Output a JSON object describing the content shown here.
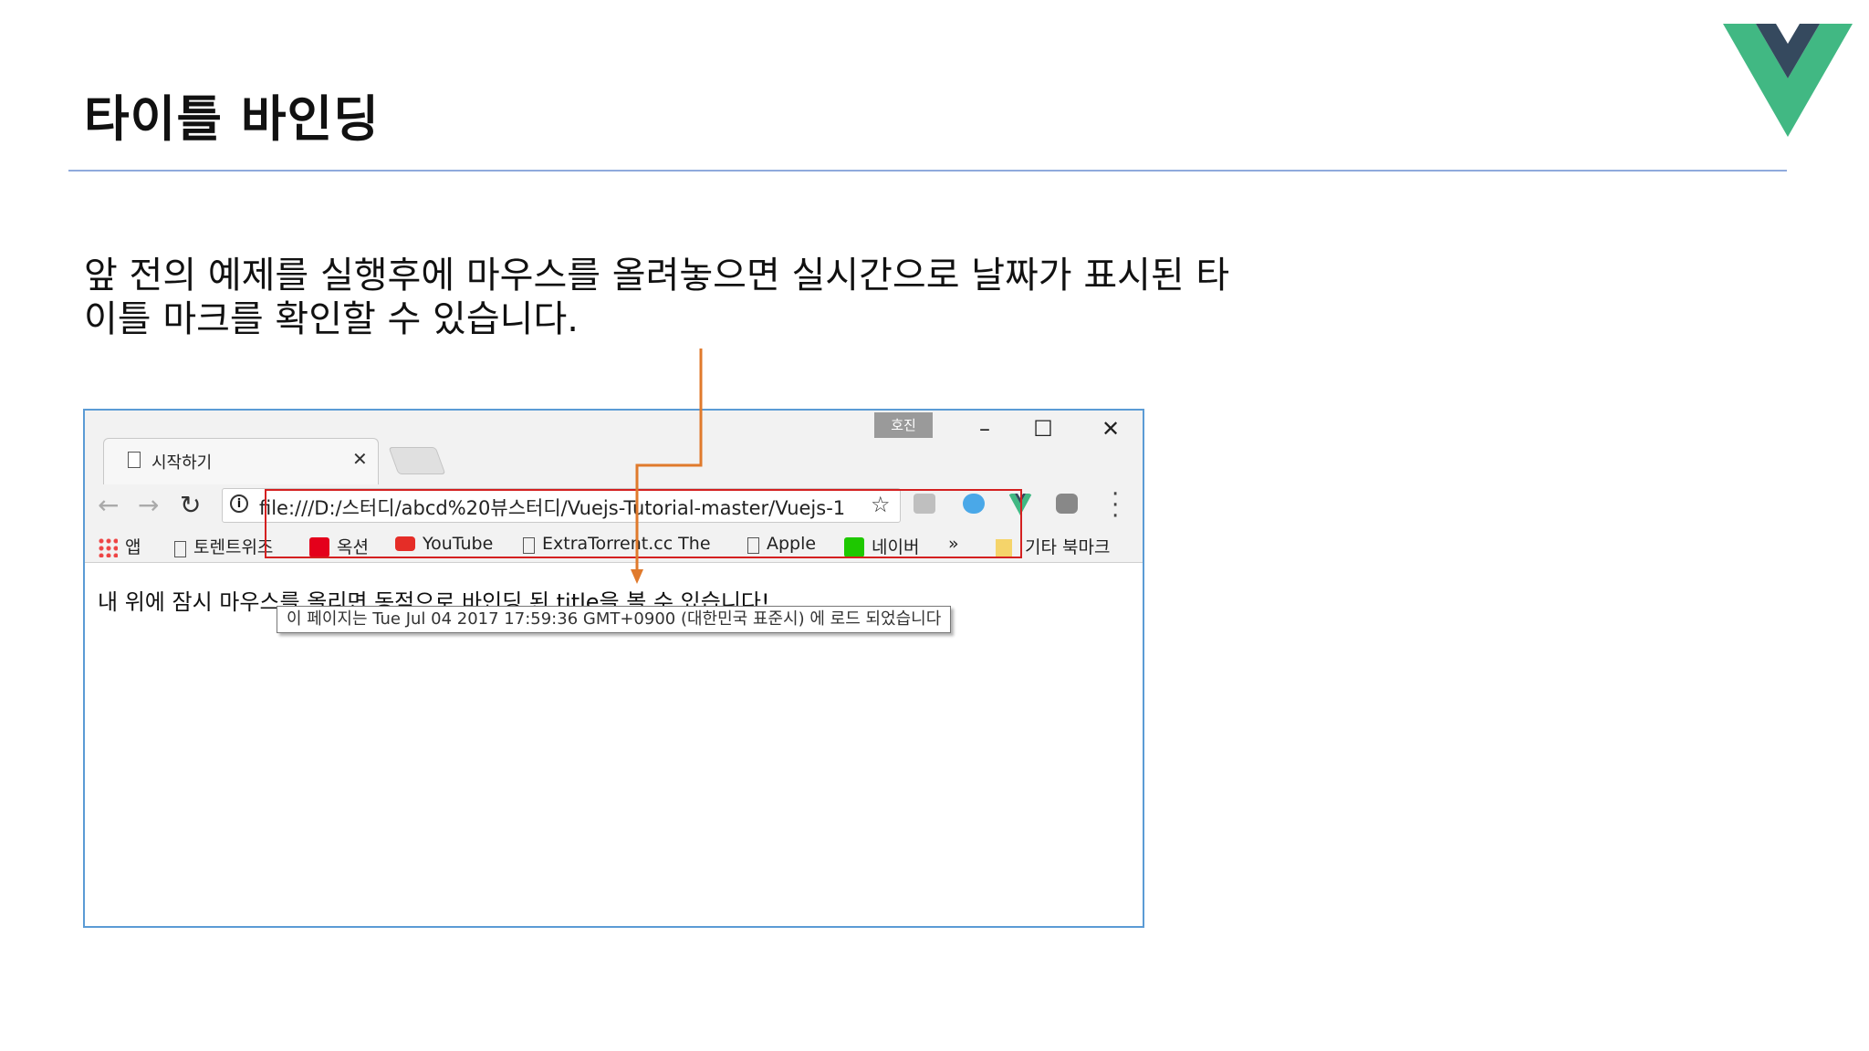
{
  "slide": {
    "title": "타이틀 바인딩",
    "description_line1": "앞 전의 예제를 실행후에 마우스를 올려놓으면 실시간으로 날짜가 표시된 타",
    "description_line2": "이틀 마크를 확인할 수 있습니다."
  },
  "browser": {
    "tab_title": "시작하기",
    "profile_badge": "호진",
    "url": "file:///D:/스터디/abcd%20뷰스터디/Vuejs-Tutorial-master/Vuejs-1",
    "bookmarks": {
      "apps": "앱",
      "item1": "토렌트위즈",
      "item2": "옥션",
      "item3": "YouTube",
      "item4": "ExtraTorrent.cc The",
      "item5": "Apple",
      "item6": "네이버",
      "more": "»",
      "other": "기타 북마크"
    },
    "content_text": "내 위에 잠시 마우스를 올리면 동적으로 바인딩 된 title을 볼 수 있습니다!",
    "tooltip_text": "이 페이지는 Tue Jul 04 2017 17:59:36 GMT+0900 (대한민국 표준시) 에 로드 되었습니다"
  },
  "colors": {
    "rule": "#8faadc",
    "browser_border": "#5b9bd5",
    "highlight": "#d42020",
    "arrow": "#e07a2c",
    "vue_green": "#41b883",
    "vue_dark": "#35495e"
  },
  "icons": [
    "vue-logo-icon",
    "page-icon",
    "close-icon",
    "back-arrow-icon",
    "forward-arrow-icon",
    "reload-icon",
    "info-icon",
    "star-icon",
    "menu-dots-icon",
    "apps-grid-icon"
  ]
}
